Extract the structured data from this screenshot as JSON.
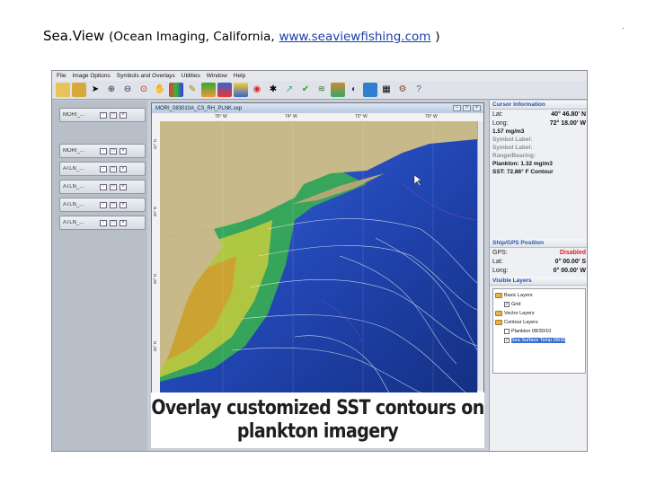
{
  "slide": {
    "title_main": "Sea.View",
    "title_sub": "(Ocean Imaging, California,",
    "title_link": "www.seaviewfishing.com",
    "title_close": ")",
    "corner_mark": "."
  },
  "menubar": [
    "File",
    "Image Options",
    "Symbols and Overlays",
    "Utilities",
    "Window",
    "Help"
  ],
  "toolbar_icons": [
    "folder-open-icon",
    "folder-icon",
    "pointer-icon",
    "zoom-in-icon",
    "zoom-out-icon",
    "zoom-box-icon",
    "pan-hand-icon",
    "color-palette-icon",
    "ruler-icon",
    "layers-icon",
    "crop-icon",
    "export-icon",
    "target-icon",
    "spider-icon",
    "arrow-icon",
    "checkmark-icon",
    "waves-icon",
    "stack-icon",
    "contrast-icon",
    "cube-icon",
    "grid-icon",
    "settings-icon",
    "help-icon"
  ],
  "left_panel": {
    "docs": [
      "MORI_...",
      "MORI_...",
      "ATLN_...",
      "ATLN_...",
      "ATLN_...",
      "ATLN_..."
    ]
  },
  "map_window": {
    "title": "MORI_083010A_C3_RH_PLNK.sxp",
    "lon_ticks": [
      "76° W",
      "74° W",
      "72° W",
      "70° W"
    ],
    "lat_ticks": [
      "42° N",
      "40° N",
      "38° N",
      "36° N"
    ]
  },
  "caption": {
    "line1": "Overlay customized SST contours on",
    "line2": "plankton imagery"
  },
  "cursor_info": {
    "header": "Cursor Information",
    "lat_label": "Lat:",
    "lat_value": "40° 46.80' N",
    "long_label": "Long:",
    "long_value": "72° 18.00' W",
    "value": "1.57 mg/m3",
    "symbol_label1": "Symbol Label:",
    "symbol_label2": "Symbol Label:",
    "range_bearing": "Range/Bearing:",
    "plankton": "Plankton: 1.32 mg/m3",
    "sst": "SST: 72.86° F Contour"
  },
  "ship_gps": {
    "header": "Ship/GPS Position",
    "gps_label": "GPS:",
    "gps_value": "Disabled",
    "lat_label": "Lat:",
    "lat_value": "0° 00.00' S",
    "long_label": "Long:",
    "long_value": "0° 00.00' W"
  },
  "visible_layers": {
    "header": "Visible Layers",
    "basic": "Basic Layers",
    "grid": "Grid",
    "vector": "Vector Layers",
    "contour": "Contour Layers",
    "plankton": "Plankton 08/30/10",
    "sst": "Sea Surface Temp 08/30"
  },
  "colors": {
    "title_link": "#1a3fa8",
    "panel_header": "#2552a8",
    "disabled": "#d22222",
    "land": "#c8b98a",
    "deep_water": "#1b3a8f",
    "plankton_green": "#39b54a"
  }
}
